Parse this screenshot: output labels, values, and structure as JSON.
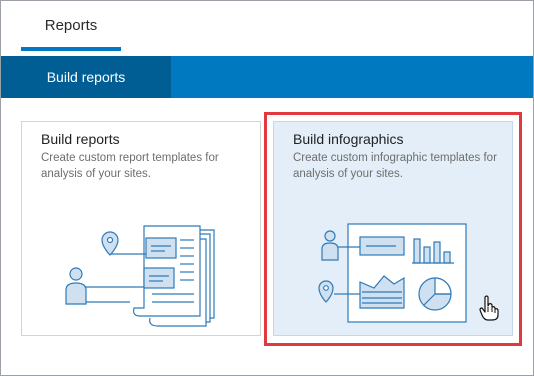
{
  "top_tabs": [
    {
      "label": "Reports",
      "active": true
    }
  ],
  "ribbon": {
    "tabs": [
      {
        "label": "Build reports",
        "active": true
      }
    ]
  },
  "cards": [
    {
      "title": "Build reports",
      "description": "Create custom report templates for analysis of your sites.",
      "illustration": "report-template-icon",
      "selected": false
    },
    {
      "title": "Build infographics",
      "description": "Create custom infographic templates for analysis of your sites.",
      "illustration": "infographic-template-icon",
      "selected": true
    }
  ],
  "colors": {
    "accent": "#0079c1",
    "accent_dark": "#005e95",
    "selected_card_bg": "#e3eef8",
    "highlight_border": "#e03a3e",
    "icon_stroke": "#2f7ab8",
    "icon_fill": "#cfe1f1"
  },
  "cursor": {
    "icon": "hand-pointer-icon"
  }
}
